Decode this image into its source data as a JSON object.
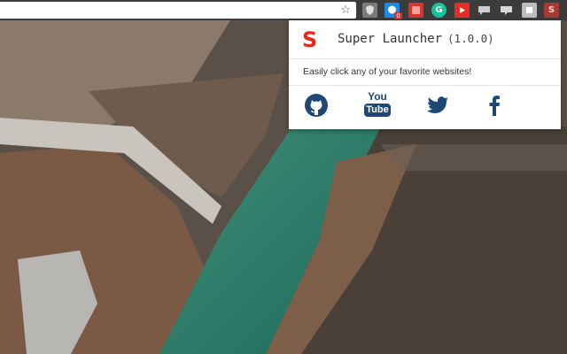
{
  "browser": {
    "bookmark_icon": "star-icon",
    "extensions": [
      {
        "name": "shield-extension",
        "icon": "shield-icon",
        "color": "#7a7a7a"
      },
      {
        "name": "skype-extension",
        "icon": "chat-icon",
        "color": "#1e88e5",
        "badge": "0"
      },
      {
        "name": "red-square-extension",
        "icon": "square-icon",
        "color": "#d9362b"
      },
      {
        "name": "grammarly-extension",
        "icon": "g-icon",
        "color": "#15c39a",
        "glyph": "G"
      },
      {
        "name": "youtube-extension",
        "icon": "play-icon",
        "color": "#e52d27"
      },
      {
        "name": "speech-extension",
        "icon": "speech-bubble-icon",
        "color": "#cfcfcf"
      },
      {
        "name": "message-extension",
        "icon": "message-icon",
        "color": "#cfcfcf"
      },
      {
        "name": "puzzle-extension",
        "icon": "puzzle-icon",
        "color": "#bdbdbd"
      },
      {
        "name": "super-launcher-extension",
        "icon": "s-icon",
        "color": "#e8261a",
        "glyph": "S"
      }
    ]
  },
  "popup": {
    "logo_letter": "S",
    "title": "Super Launcher",
    "version": "(1.0.0)",
    "description": "Easily click any of your favorite websites!",
    "links": [
      {
        "name": "github-link",
        "icon": "github-icon"
      },
      {
        "name": "youtube-link",
        "icon": "youtube-icon",
        "label_top": "You",
        "label_bottom": "Tube"
      },
      {
        "name": "twitter-link",
        "icon": "twitter-icon"
      },
      {
        "name": "facebook-link",
        "icon": "facebook-icon"
      }
    ],
    "accent_color": "#e8261a",
    "icon_color": "#1f4876"
  }
}
